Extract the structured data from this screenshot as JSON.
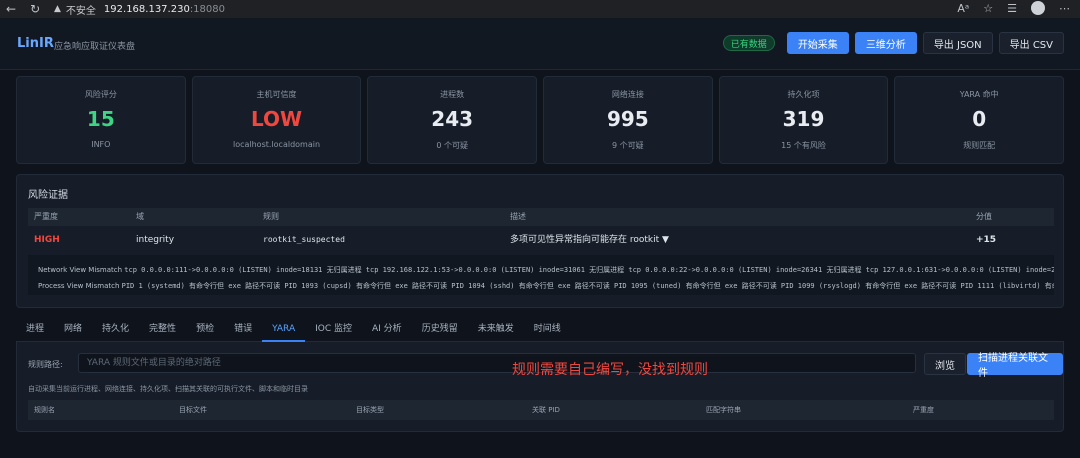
{
  "browser": {
    "security_label": "不安全",
    "host": "192.168.137.230",
    "port": ":18080"
  },
  "header": {
    "brand": "LinIR",
    "subtitle": "应急响应取证仪表盘",
    "status_badge": "已有数据",
    "buttons": {
      "start_collect": "开始采集",
      "three_d": "三维分析",
      "export_json": "导出 JSON",
      "export_csv": "导出 CSV"
    }
  },
  "cards": [
    {
      "label": "风险评分",
      "value": "15",
      "sub": "INFO",
      "color": "#3fd483"
    },
    {
      "label": "主机可信度",
      "value": "LOW",
      "sub": "localhost.localdomain",
      "color": "#f0473f"
    },
    {
      "label": "进程数",
      "value": "243",
      "sub": "0 个可疑",
      "color": "#e8ecf1"
    },
    {
      "label": "网络连接",
      "value": "995",
      "sub": "9 个可疑",
      "color": "#e8ecf1"
    },
    {
      "label": "持久化项",
      "value": "319",
      "sub": "15 个有风险",
      "color": "#e8ecf1"
    },
    {
      "label": "YARA 命中",
      "value": "0",
      "sub": "规则匹配",
      "color": "#e8ecf1"
    }
  ],
  "risk": {
    "title": "风险证据",
    "columns": [
      "严重度",
      "域",
      "规则",
      "描述",
      "分值"
    ],
    "row": {
      "severity": "HIGH",
      "domain": "integrity",
      "rule": "rootkit_suspected",
      "description": "多项可见性异常指向可能存在 rootkit ▼",
      "score": "+15"
    },
    "detail": {
      "network_label": "Network View Mismatch",
      "network_value": "tcp 0.0.0.0:111->0.0.0.0:0 (LISTEN) inode=18131 无归属进程  tcp 192.168.122.1:53->0.0.0.0:0 (LISTEN) inode=31061 无归属进程  tcp 0.0.0.0:22->0.0.0.0:0 (LISTEN) inode=26341 无归属进程  tcp 127.0.0.1:631->0.0.0.0:0 (LISTEN) inode=28715 无归属进程  t",
      "process_label": "Process View Mismatch",
      "process_value": "PID 1 (systemd) 有命令行但 exe 路径不可读  PID 1093 (cupsd) 有命令行但 exe 路径不可读  PID 1094 (sshd) 有命令行但 exe 路径不可读  PID 1095 (tuned) 有命令行但 exe 路径不可读  PID 1099 (rsyslogd) 有命令行但 exe 路径不可读  PID 1111 (libvirtd) 有命令行但"
    }
  },
  "tabs": [
    "进程",
    "网络",
    "持久化",
    "完整性",
    "预检",
    "错误",
    "YARA",
    "IOC 监控",
    "AI 分析",
    "历史残留",
    "未来触发",
    "时间线"
  ],
  "active_tab": "YARA",
  "yara": {
    "path_label": "规则路径:",
    "path_placeholder": "YARA 规则文件或目录的绝对路径",
    "browse": "浏览",
    "scan": "扫描进程关联文件",
    "hint": "自动采集当前运行进程、网络连接、持久化项、扫描其关联的可执行文件、脚本和临时目录",
    "columns": [
      "规则名",
      "目标文件",
      "目标类型",
      "关联 PID",
      "匹配字符串",
      "严重度"
    ]
  },
  "annotation": "规则需要自己编写，没找到规则"
}
